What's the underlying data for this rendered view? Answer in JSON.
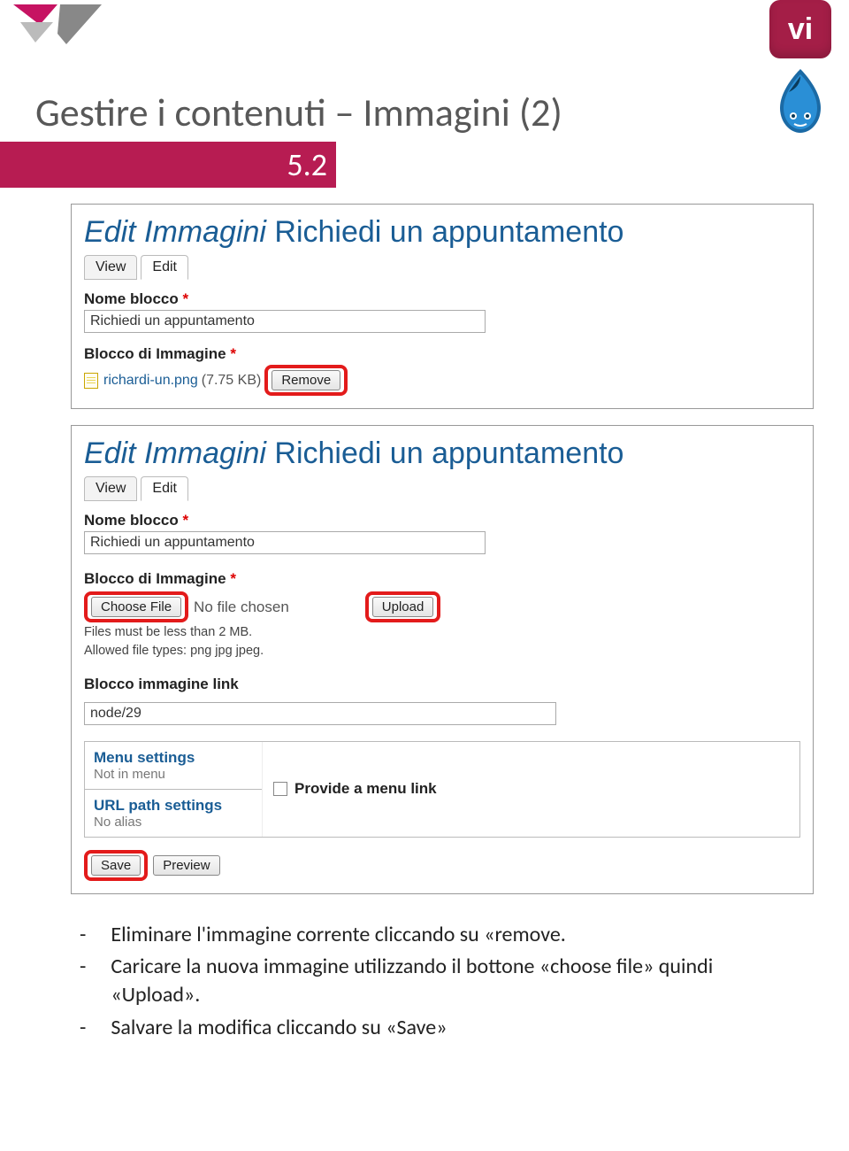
{
  "header": {
    "vi_badge": "vi"
  },
  "title": "Gestire i contenuti – Immagini (2)",
  "section_number": "5.2",
  "shot1": {
    "title_em": "Edit Immagini",
    "title_nm": " Richiedi un appuntamento",
    "tab_view": "View",
    "tab_edit": "Edit",
    "nome_blocco_label": "Nome blocco",
    "nome_blocco_value": "Richiedi un appuntamento",
    "blocco_img_label": "Blocco di Immagine",
    "filename": "richardi-un.png",
    "filesize": "(7.75 KB)",
    "remove_btn": "Remove"
  },
  "shot2": {
    "title_em": "Edit Immagini",
    "title_nm": " Richiedi un appuntamento",
    "tab_view": "View",
    "tab_edit": "Edit",
    "nome_blocco_label": "Nome blocco",
    "nome_blocco_value": "Richiedi un appuntamento",
    "blocco_img_label": "Blocco di Immagine",
    "choose_file_btn": "Choose File",
    "no_file": "No file chosen",
    "upload_btn": "Upload",
    "hint1": "Files must be less than 2 MB.",
    "hint2": "Allowed file types: png jpg jpeg.",
    "blocco_link_label": "Blocco immagine link",
    "blocco_link_value": "node/29",
    "menu_settings": "Menu settings",
    "menu_settings_sub": "Not in menu",
    "provide_menu": "Provide a menu link",
    "url_settings": "URL path settings",
    "url_settings_sub": "No alias",
    "save_btn": "Save",
    "preview_btn": "Preview"
  },
  "bullets": {
    "b1": "Eliminare l'immagine corrente cliccando su «remove.",
    "b2": "Caricare la nuova immagine utilizzando il bottone «choose file» quindi «Upload».",
    "b3": "Salvare la modifica cliccando su «Save»"
  }
}
